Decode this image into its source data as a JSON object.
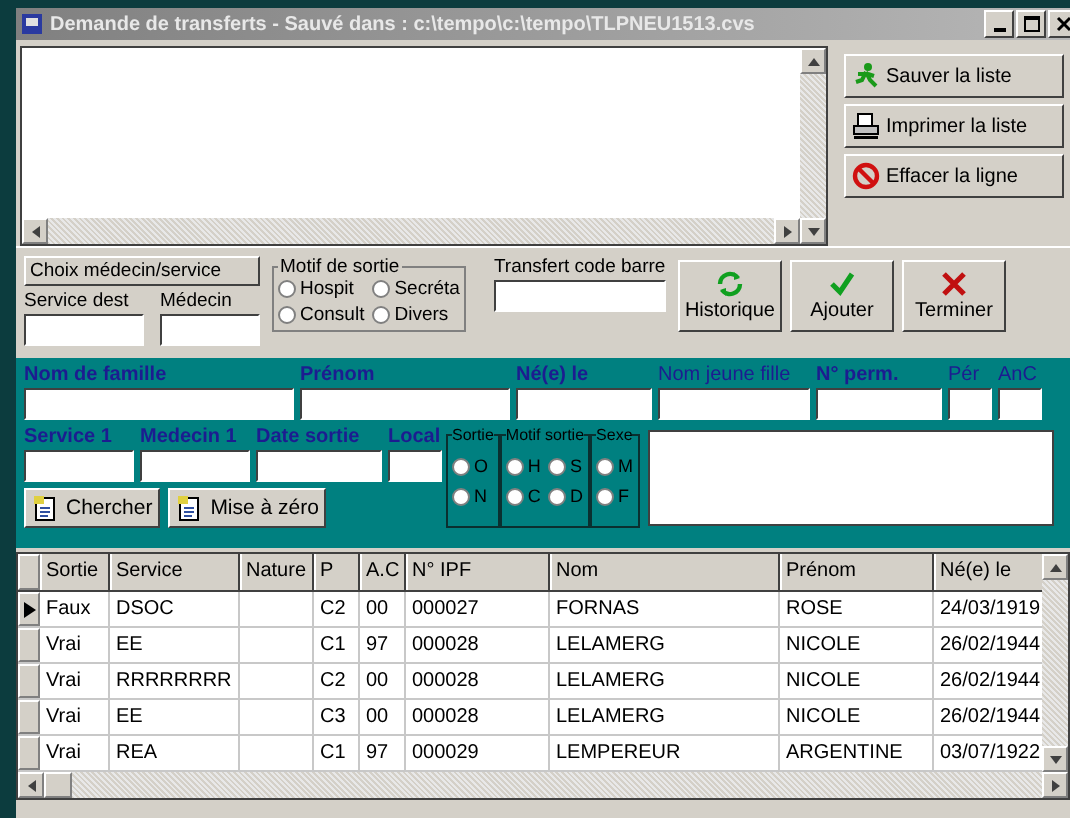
{
  "window": {
    "title": "Demande de transferts - Sauvé dans : c:\\tempo\\c:\\tempo\\TLPNEU1513.cvs"
  },
  "side_buttons": [
    {
      "label": "Sauver la liste",
      "kind": "save"
    },
    {
      "label": "Imprimer la liste",
      "kind": "print"
    },
    {
      "label": "Effacer la ligne",
      "kind": "delete"
    }
  ],
  "choice_button": "Choix médecin/service",
  "service_dest": {
    "label": "Service dest"
  },
  "medecin": {
    "label": "Médecin"
  },
  "motif_sortie": {
    "legend": "Motif de sortie",
    "options": [
      {
        "label": "Hospit",
        "selected": false
      },
      {
        "label": "Secréta",
        "selected": false
      },
      {
        "label": "Consult",
        "selected": false
      },
      {
        "label": "Divers",
        "selected": false
      }
    ]
  },
  "barcode": {
    "label": "Transfert code barre"
  },
  "action_buttons": [
    {
      "label": "Historique",
      "kind": "history"
    },
    {
      "label": "Ajouter",
      "kind": "add"
    },
    {
      "label": "Terminer",
      "kind": "close"
    }
  ],
  "search_fields_1": [
    {
      "label": "Nom de famille",
      "bold": true
    },
    {
      "label": "Prénom",
      "bold": true
    },
    {
      "label": "Né(e) le",
      "bold": true
    },
    {
      "label": "Nom jeune fille",
      "bold": false
    },
    {
      "label": "N° perm.",
      "bold": true
    },
    {
      "label": "Pér",
      "bold": false
    },
    {
      "label": "AnC",
      "bold": false
    }
  ],
  "search_fields_2": [
    {
      "label": "Service 1"
    },
    {
      "label": "Medecin 1"
    },
    {
      "label": "Date sortie"
    },
    {
      "label": "Local"
    }
  ],
  "radio_groups": [
    {
      "legend": "Sortie",
      "options": [
        {
          "label": "O",
          "selected": false
        },
        {
          "label": "N",
          "selected": false
        }
      ]
    },
    {
      "legend": "Motif sortie",
      "options": [
        {
          "label": "H",
          "selected": false
        },
        {
          "label": "S",
          "selected": false
        },
        {
          "label": "C",
          "selected": false
        },
        {
          "label": "D",
          "selected": false
        }
      ]
    },
    {
      "legend": "Sexe",
      "options": [
        {
          "label": "M",
          "selected": false
        },
        {
          "label": "F",
          "selected": false
        }
      ]
    }
  ],
  "search_buttons": [
    {
      "label": "Chercher"
    },
    {
      "label": "Mise à zéro"
    }
  ],
  "table": {
    "columns": [
      "Sortie",
      "Service",
      "Nature",
      "P",
      "A.C",
      "N° IPF",
      "Nom",
      "Prénom",
      "Né(e) le"
    ],
    "rows": [
      {
        "selected": true,
        "cells": [
          "Faux",
          "DSOC",
          "",
          "C2",
          "00",
          "000027",
          "FORNAS",
          "ROSE",
          "24/03/1919"
        ]
      },
      {
        "selected": false,
        "cells": [
          "Vrai",
          "EE",
          "",
          "C1",
          "97",
          "000028",
          "LELAMERG",
          "NICOLE",
          "26/02/1944"
        ]
      },
      {
        "selected": false,
        "cells": [
          "Vrai",
          "RRRRRRRR",
          "",
          "C2",
          "00",
          "000028",
          "LELAMERG",
          "NICOLE",
          "26/02/1944"
        ]
      },
      {
        "selected": false,
        "cells": [
          "Vrai",
          "EE",
          "",
          "C3",
          "00",
          "000028",
          "LELAMERG",
          "NICOLE",
          "26/02/1944"
        ]
      },
      {
        "selected": false,
        "cells": [
          "Vrai",
          "REA",
          "",
          "C1",
          "97",
          "000029",
          "LEMPEREUR",
          "ARGENTINE",
          "03/07/1922"
        ]
      }
    ]
  }
}
